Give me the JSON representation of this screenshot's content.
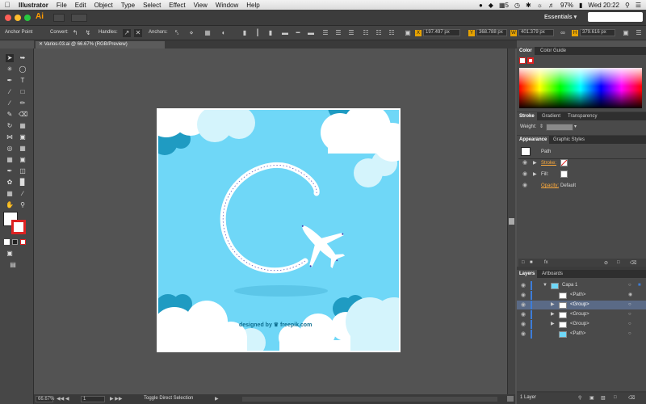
{
  "menubar": {
    "app": "Illustrator",
    "items": [
      "File",
      "Edit",
      "Object",
      "Type",
      "Select",
      "Effect",
      "View",
      "Window",
      "Help"
    ],
    "battery": "97%",
    "clock": "Wed 20:22",
    "badge": "5"
  },
  "appbar": {
    "logo": "Ai",
    "workspace": "Essentials"
  },
  "control": {
    "tool_name": "Anchor Point",
    "convert_label": "Convert:",
    "handles_label": "Handles:",
    "anchors_label": "Anchors:",
    "x_value": "197.497 px",
    "y_value": "368.788 px",
    "w_value": "401.379 px",
    "h_value": "379.616 px"
  },
  "document": {
    "tab_title": "Varios-03.ai @ 66.67% (RGB/Preview)",
    "credit": "designed by ♛ freepik.com"
  },
  "status": {
    "zoom": "66.67%",
    "artboard_num": "1",
    "tool_hint": "Toggle Direct Selection"
  },
  "panels": {
    "color_tabs": [
      "Color",
      "Color Guide"
    ],
    "stroke_tabs": [
      "Stroke",
      "Gradient",
      "Transparency"
    ],
    "weight_label": "Weight:",
    "appearance_tabs": [
      "Appearance",
      "Graphic Styles"
    ],
    "appearance_item": "Path",
    "stroke_label": "Stroke:",
    "fill_label": "Fill:",
    "opacity_label": "Opacity:",
    "opacity_value": "Default",
    "layers_tabs": [
      "Layers",
      "Artboards"
    ],
    "layers": [
      {
        "name": "Capa 1"
      },
      {
        "name": "<Path>"
      },
      {
        "name": "<Group>"
      },
      {
        "name": "<Group>"
      },
      {
        "name": "<Group>"
      },
      {
        "name": "<Path>"
      }
    ],
    "layers_count": "1 Layer"
  },
  "colors": {
    "sky": "#6fd7f7",
    "dark_cloud": "#1f9bc2",
    "light_cloud": "#d4f4fc",
    "accent": "#ff9a00"
  }
}
